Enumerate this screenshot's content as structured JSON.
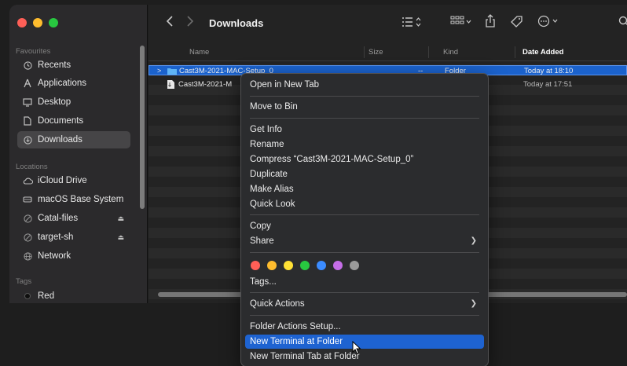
{
  "window": {
    "title": "Downloads"
  },
  "sidebar": {
    "favourites_label": "Favourites",
    "locations_label": "Locations",
    "tags_label": "Tags",
    "favourites": [
      {
        "label": "Recents",
        "icon": "clock-icon"
      },
      {
        "label": "Applications",
        "icon": "applications-icon"
      },
      {
        "label": "Desktop",
        "icon": "desktop-icon"
      },
      {
        "label": "Documents",
        "icon": "document-icon"
      },
      {
        "label": "Downloads",
        "icon": "download-icon",
        "active": true
      }
    ],
    "locations": [
      {
        "label": "iCloud Drive",
        "icon": "cloud-icon"
      },
      {
        "label": "macOS Base System",
        "icon": "disk-icon"
      },
      {
        "label": "Catal-files",
        "icon": "network-disk-icon",
        "eject": true
      },
      {
        "label": "target-sh",
        "icon": "network-disk-icon",
        "eject": true
      },
      {
        "label": "Network",
        "icon": "globe-icon"
      }
    ],
    "tags": [
      {
        "label": "Red",
        "color": "#1a1a1a"
      }
    ]
  },
  "columns": {
    "name": "Name",
    "size": "Size",
    "kind": "Kind",
    "date": "Date Added"
  },
  "files": [
    {
      "name": "Cast3M-2021-MAC-Setup_0",
      "size": "--",
      "kind": "Folder",
      "date": "Today at 18:10",
      "selected": true
    },
    {
      "name": "Cast3M-2021-M",
      "size": "",
      "kind": "",
      "date": "Today at 17:51",
      "selected": false
    }
  ],
  "context_menu": {
    "open_new_tab": "Open in New Tab",
    "move_to_bin": "Move to Bin",
    "get_info": "Get Info",
    "rename": "Rename",
    "compress": "Compress “Cast3M-2021-MAC-Setup_0”",
    "duplicate": "Duplicate",
    "make_alias": "Make Alias",
    "quick_look": "Quick Look",
    "copy": "Copy",
    "share": "Share",
    "tag_colors": [
      "#ff5f57",
      "#febc2e",
      "#ffe135",
      "#28c840",
      "#3b8cff",
      "#c66ee8",
      "#9a9a9a"
    ],
    "tags": "Tags...",
    "quick_actions": "Quick Actions",
    "folder_actions_setup": "Folder Actions Setup...",
    "new_terminal_at_folder": "New Terminal at Folder",
    "new_terminal_tab_at_folder": "New Terminal Tab at Folder"
  },
  "colors": {
    "selection": "#1b62cc",
    "menu_highlight": "#1e63d1"
  }
}
